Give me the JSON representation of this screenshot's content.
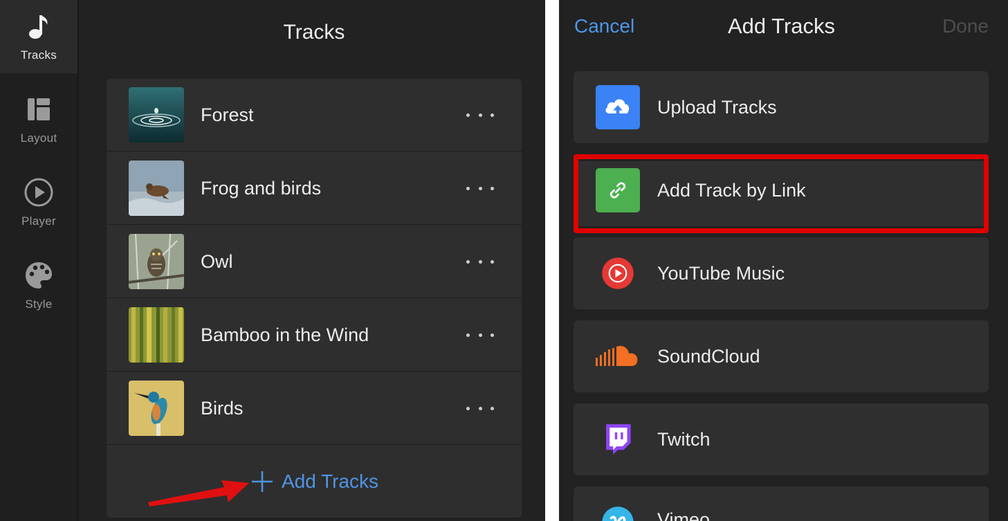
{
  "sidebar": {
    "items": [
      {
        "label": "Tracks",
        "icon": "music-note-icon",
        "active": true
      },
      {
        "label": "Layout",
        "icon": "layout-icon",
        "active": false
      },
      {
        "label": "Player",
        "icon": "play-circle-icon",
        "active": false
      },
      {
        "label": "Style",
        "icon": "palette-icon",
        "active": false
      }
    ]
  },
  "tracks_panel": {
    "title": "Tracks",
    "tracks": [
      {
        "name": "Forest",
        "thumb": "water-drop-thumbnail"
      },
      {
        "name": "Frog and birds",
        "thumb": "frog-thumbnail"
      },
      {
        "name": "Owl",
        "thumb": "owl-thumbnail"
      },
      {
        "name": "Bamboo in the Wind",
        "thumb": "bamboo-thumbnail"
      },
      {
        "name": "Birds",
        "thumb": "kingfisher-thumbnail"
      }
    ],
    "add_label": "Add Tracks"
  },
  "modal": {
    "cancel": "Cancel",
    "title": "Add Tracks",
    "done": "Done",
    "options": [
      {
        "label": "Upload Tracks",
        "icon": "cloud-upload-icon",
        "color": "#3b82f6"
      },
      {
        "label": "Add Track by Link",
        "icon": "link-icon",
        "color": "#4caf50"
      },
      {
        "label": "YouTube Music",
        "icon": "youtube-music-icon",
        "color": "#e53935"
      },
      {
        "label": "SoundCloud",
        "icon": "soundcloud-icon",
        "color": "#f26f23"
      },
      {
        "label": "Twitch",
        "icon": "twitch-icon",
        "color": "#8f45f7"
      },
      {
        "label": "Vimeo",
        "icon": "vimeo-icon",
        "color": "#35b5e8"
      }
    ]
  },
  "colors": {
    "accent": "#4e95e6",
    "highlight": "#e00000",
    "arrow": "#e01010"
  }
}
